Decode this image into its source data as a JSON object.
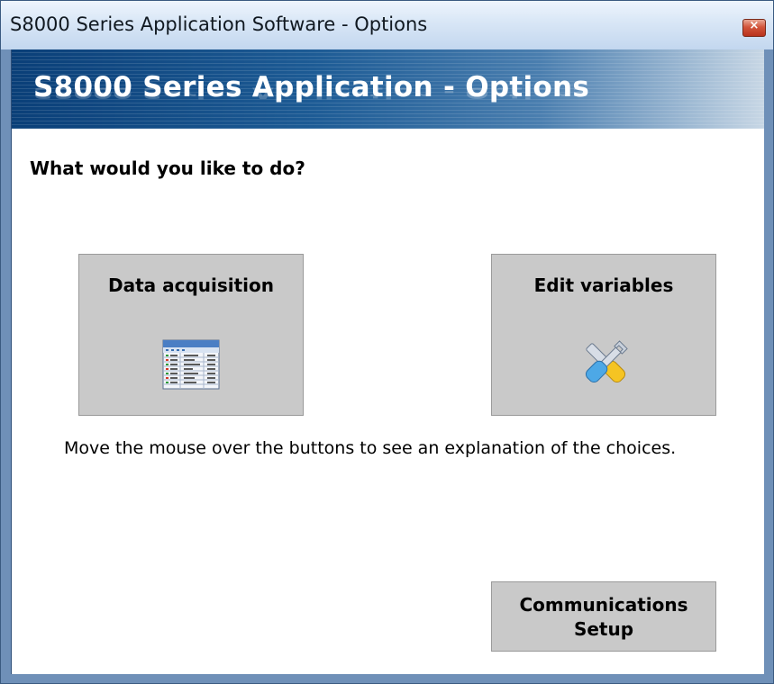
{
  "window": {
    "title": "S8000 Series Application Software - Options",
    "close_glyph": "×"
  },
  "banner": {
    "title": "S8000 Series Application - Options"
  },
  "main": {
    "prompt": "What would you like to do?",
    "buttons": [
      {
        "label": "Data acquisition",
        "icon": "data-table-icon"
      },
      {
        "label": "Edit variables",
        "icon": "tools-icon"
      }
    ],
    "hint": "Move the mouse over the buttons to see an explanation of the choices.",
    "comm_button": {
      "line1": "Communications",
      "line2": "Setup"
    }
  },
  "colors": {
    "banner_dark": "#0a3f78",
    "button_face": "#c9c9c9",
    "close_red": "#d2553b"
  }
}
